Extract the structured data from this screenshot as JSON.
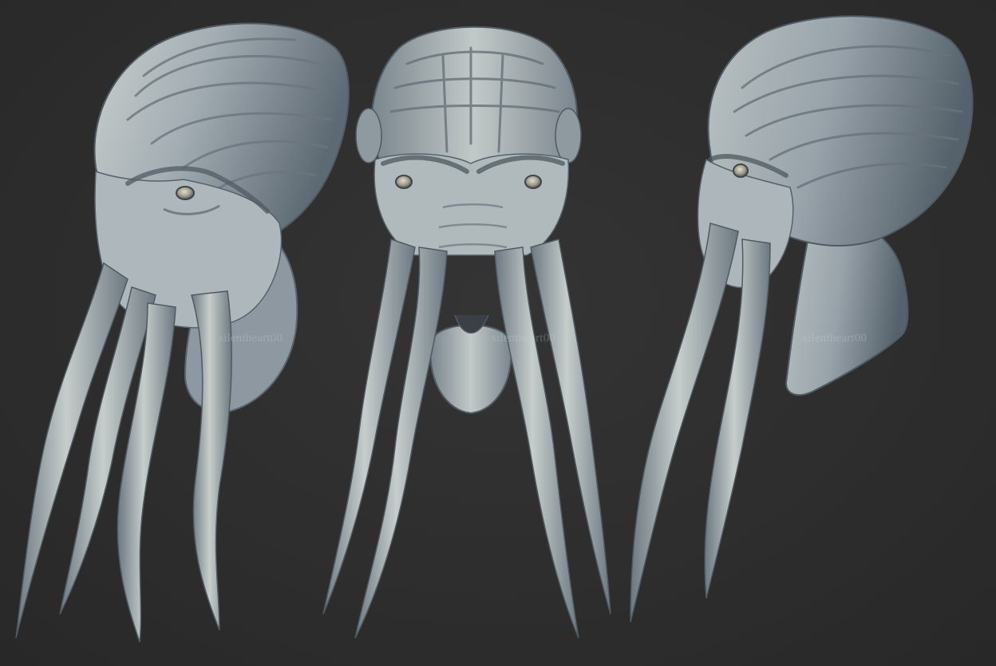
{
  "scene": {
    "background_color": "#2e2e2e",
    "material_color": "#9fa9b0",
    "material_shadow_color": "#4d5861",
    "material_highlight_color": "#dfe3e0",
    "views": [
      "three-quarter",
      "front",
      "side"
    ]
  },
  "watermarks": {
    "left": "silentheart00",
    "middle": "silentheart00",
    "right": "silentheart00"
  }
}
